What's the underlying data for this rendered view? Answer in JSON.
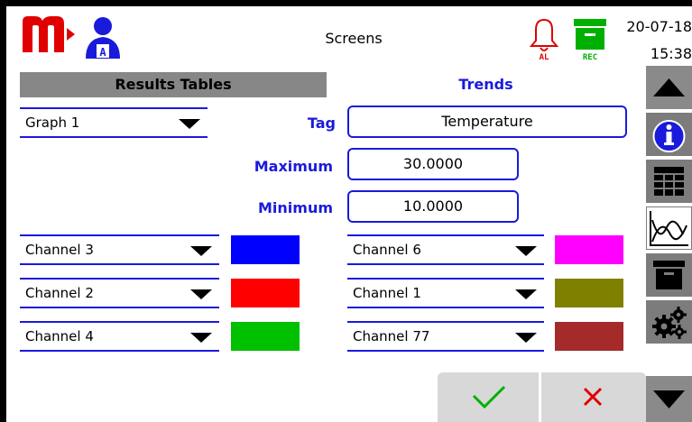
{
  "header": {
    "title": "Screens",
    "date": "20-07-18",
    "time": "15:38",
    "alarm_label": "AL",
    "rec_label": "REC"
  },
  "tabs": {
    "results_label": "Results Tables",
    "trends_label": "Trends"
  },
  "graph": {
    "selected": "Graph 1"
  },
  "tag": {
    "label": "Tag",
    "value": "Temperature"
  },
  "maximum": {
    "label": "Maximum",
    "value": "30.0000"
  },
  "minimum": {
    "label": "Minimum",
    "value": "10.0000"
  },
  "channels_left": [
    {
      "name": "Channel 3",
      "color": "#0000ff"
    },
    {
      "name": "Channel 2",
      "color": "#ff0000"
    },
    {
      "name": "Channel 4",
      "color": "#00c000"
    }
  ],
  "channels_right": [
    {
      "name": "Channel 6",
      "color": "#ff00ff"
    },
    {
      "name": "Channel 1",
      "color": "#808000"
    },
    {
      "name": "Channel 77",
      "color": "#a52a2a"
    }
  ],
  "sidebar_icons": [
    "up-arrow-icon",
    "info-icon",
    "table-icon",
    "trend-chart-icon",
    "archive-icon",
    "settings-gears-icon",
    "down-arrow-icon"
  ],
  "actions": {
    "ok_icon": "checkmark-icon",
    "cancel_icon": "x-icon"
  },
  "colors": {
    "accent": "#1a1adc",
    "brand_red": "#e00000",
    "rec_green": "#00b000"
  }
}
